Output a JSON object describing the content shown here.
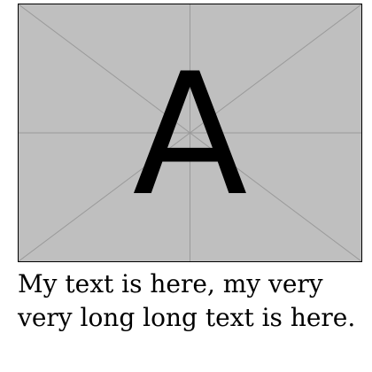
{
  "figure": {
    "placeholder_letter": "A",
    "background_color": "#bfbfbf",
    "line_color": "#9a9a9a",
    "border_color": "#000000"
  },
  "caption": {
    "text": "My text is here, my very very long long text is here."
  }
}
